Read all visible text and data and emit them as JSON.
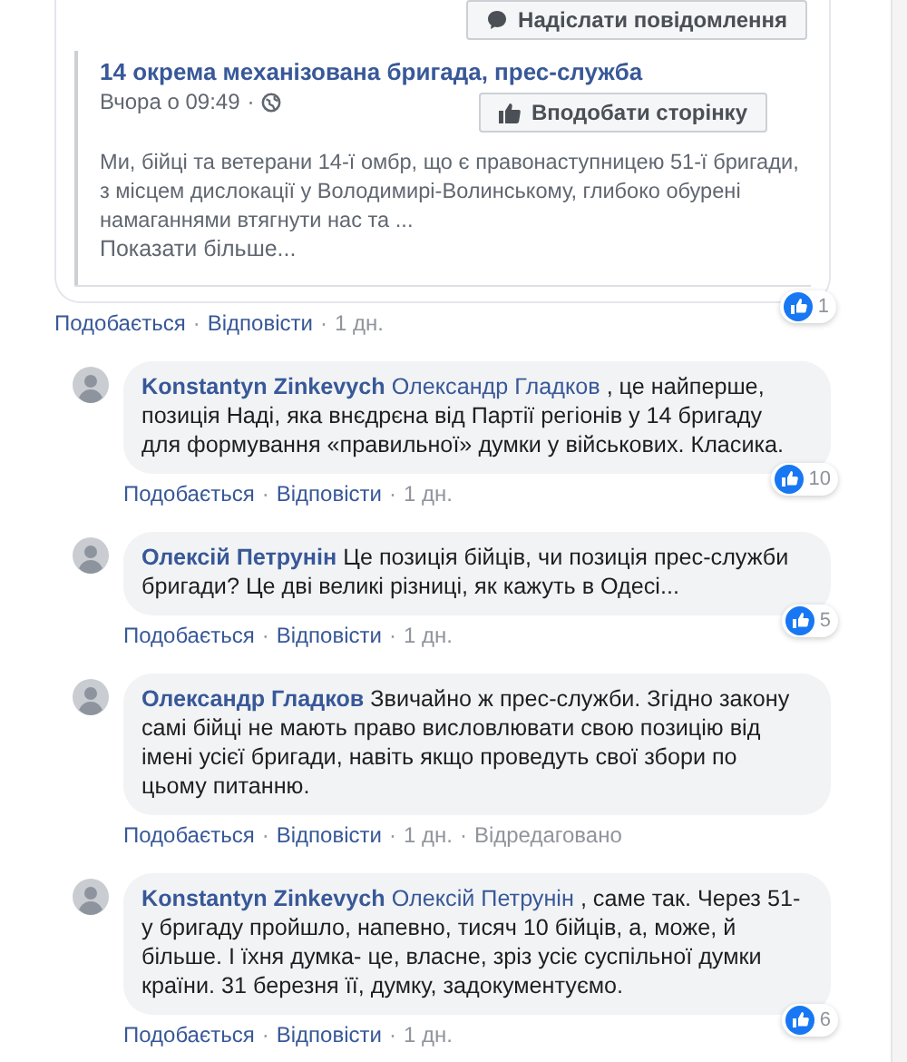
{
  "separator": "·",
  "shared_post": {
    "message_button": "Надіслати повідомлення",
    "page_name": "14 окрема механізована бригада, прес-служба",
    "time": "Вчора о 09:49",
    "like_page_button": "Вподобати сторінку",
    "excerpt": "Ми, бійці та ветерани 14-ї омбр, що є правонаступницею 51-ї бригади, з місцем дислокації у Володимирі-Волинському, глибоко обурені намаганнями втягнути нас та ...",
    "show_more": "Показати більше...",
    "reaction_count": "1",
    "actions": [
      "Подобається",
      "Відповісти",
      "1 дн."
    ]
  },
  "comments": [
    {
      "author": "Konstantyn Zinkevych",
      "mention": "Олександр Гладков",
      "text": ", це найперше, позиція Наді, яка внєдрєна від Партії регіонів у 14 бригаду для формування «правильної» думки у військових. Класика.",
      "reaction_count": "10",
      "actions": [
        "Подобається",
        "Відповісти",
        "1 дн."
      ]
    },
    {
      "author": "Олексій Петрунін",
      "text": "Це позиція бійців, чи позиція прес-служби бригади? Це дві великі різниці, як кажуть в Одесі...",
      "reaction_count": "5",
      "actions": [
        "Подобається",
        "Відповісти",
        "1 дн."
      ]
    },
    {
      "author": "Олександр Гладков",
      "text": "Звичайно ж прес-служби. Згідно закону самі бійці не мають право висловлювати свою позицію від імені усієї бригади, навіть якщо проведуть свої збори по цьому питанню.",
      "actions": [
        "Подобається",
        "Відповісти",
        "1 дн.",
        "Відредаговано"
      ]
    },
    {
      "author": "Konstantyn Zinkevych",
      "mention": "Олексій Петрунін",
      "text": ", саме так. Через 51-у бригаду пройшло, напевно, тисяч 10 бійців, а, може, й більше. І їхня думка- це, власне, зріз усіє суспільної думки країни. 31 березня її, думку, задокументуємо.",
      "reaction_count": "6",
      "actions": [
        "Подобається",
        "Відповісти",
        "1 дн."
      ]
    }
  ]
}
